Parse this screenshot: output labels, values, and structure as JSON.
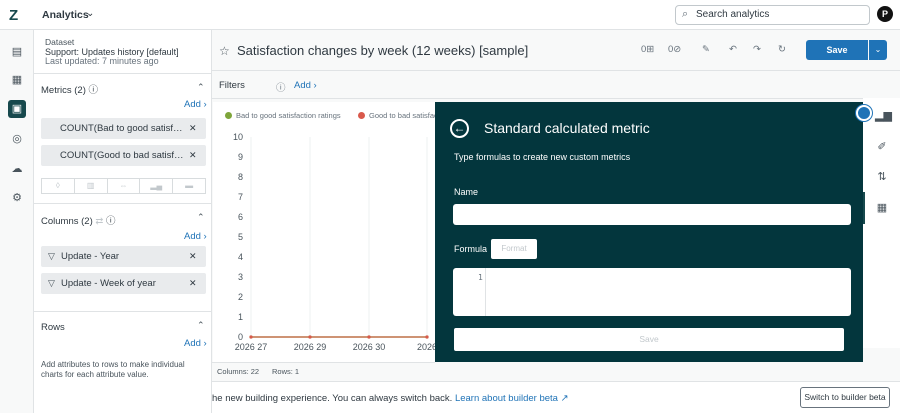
{
  "app": {
    "logo": "Z",
    "title": "Analytics",
    "chevron": "⌄"
  },
  "search": {
    "placeholder": "Search analytics"
  },
  "avatar": {
    "initial": "P"
  },
  "dataset": {
    "label": "Dataset",
    "name": "Support: Updates history [default]",
    "updated": "Last updated: 7 minutes ago"
  },
  "metrics": {
    "title": "Metrics (2)",
    "add": "Add ›",
    "items": [
      {
        "label": "COUNT(Bad to good satisfaction ratings)"
      },
      {
        "label": "COUNT(Good to bad satisfaction ratings)"
      }
    ]
  },
  "columns": {
    "title": "Columns (2)",
    "add": "Add ›",
    "items": [
      {
        "label": "Update - Year"
      },
      {
        "label": "Update - Week of year"
      }
    ]
  },
  "rows": {
    "title": "Rows",
    "add": "Add ›",
    "help": "Add attributes to rows to make individual charts for each attribute value."
  },
  "report": {
    "title": "Satisfaction changes by week (12 weeks) [sample]"
  },
  "toolbar": {
    "count_a": "0",
    "count_b": "0",
    "save": "Save"
  },
  "filters": {
    "label": "Filters",
    "add": "Add ›"
  },
  "chart_data": {
    "type": "line",
    "series": [
      {
        "name": "Bad to good satisfaction ratings",
        "color": "#7ea53a",
        "values": [
          0,
          0,
          0,
          0
        ]
      },
      {
        "name": "Good to bad satisfaction ratings",
        "color": "#d9594c",
        "values": [
          0,
          0,
          0,
          0
        ]
      }
    ],
    "categories": [
      "2026 27",
      "2026 29",
      "2026 30",
      "2026"
    ],
    "yticks": [
      "0",
      "1",
      "2",
      "3",
      "4",
      "5",
      "6",
      "7",
      "8",
      "9",
      "10"
    ],
    "ylim": [
      0,
      10
    ]
  },
  "stats": {
    "columns": "Columns: 22",
    "rows": "Rows: 1"
  },
  "modal": {
    "title": "Standard calculated metric",
    "subtitle": "Type formulas to create new custom metrics",
    "name_label": "Name",
    "name_value": "",
    "formula_label": "Formula",
    "format_label": "Format",
    "line_number": "1",
    "save_label": "Save"
  },
  "banner": {
    "text": "he new building experience. You can always switch back.",
    "link": "Learn about builder beta ↗",
    "button": "Switch to builder beta"
  }
}
